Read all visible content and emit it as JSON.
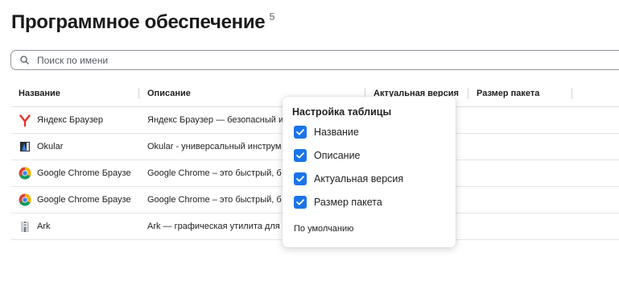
{
  "header": {
    "title": "Программное обеспечение",
    "count": "5"
  },
  "search": {
    "placeholder": "Поиск по имени"
  },
  "table": {
    "columns": [
      "Название",
      "Описание",
      "Актуальная версия",
      "Размер пакета"
    ],
    "rows": [
      {
        "name": "Яндекс Браузер",
        "description": "Яндекс Браузер — безопасный и",
        "icon": "yandex-browser-icon"
      },
      {
        "name": "Okular",
        "description": "Okular - универсальный инструм",
        "icon": "okular-icon"
      },
      {
        "name": "Google Chrome Браузе",
        "description": "Google Chrome – это быстрый, б",
        "icon": "chrome-icon"
      },
      {
        "name": "Google Chrome Браузе",
        "description": "Google Chrome – это быстрый, б",
        "icon": "chrome-icon"
      },
      {
        "name": "Ark",
        "description": "Ark — графическая утилита для",
        "icon": "ark-icon"
      }
    ]
  },
  "column_settings": {
    "title": "Настройка таблицы",
    "options": [
      {
        "label": "Название",
        "checked": true
      },
      {
        "label": "Описание",
        "checked": true
      },
      {
        "label": "Актуальная версия",
        "checked": true
      },
      {
        "label": "Размер пакета",
        "checked": true
      }
    ],
    "reset_label": "По умолчанию"
  },
  "colors": {
    "accent": "#1c74e8",
    "border": "#8f96a0"
  }
}
